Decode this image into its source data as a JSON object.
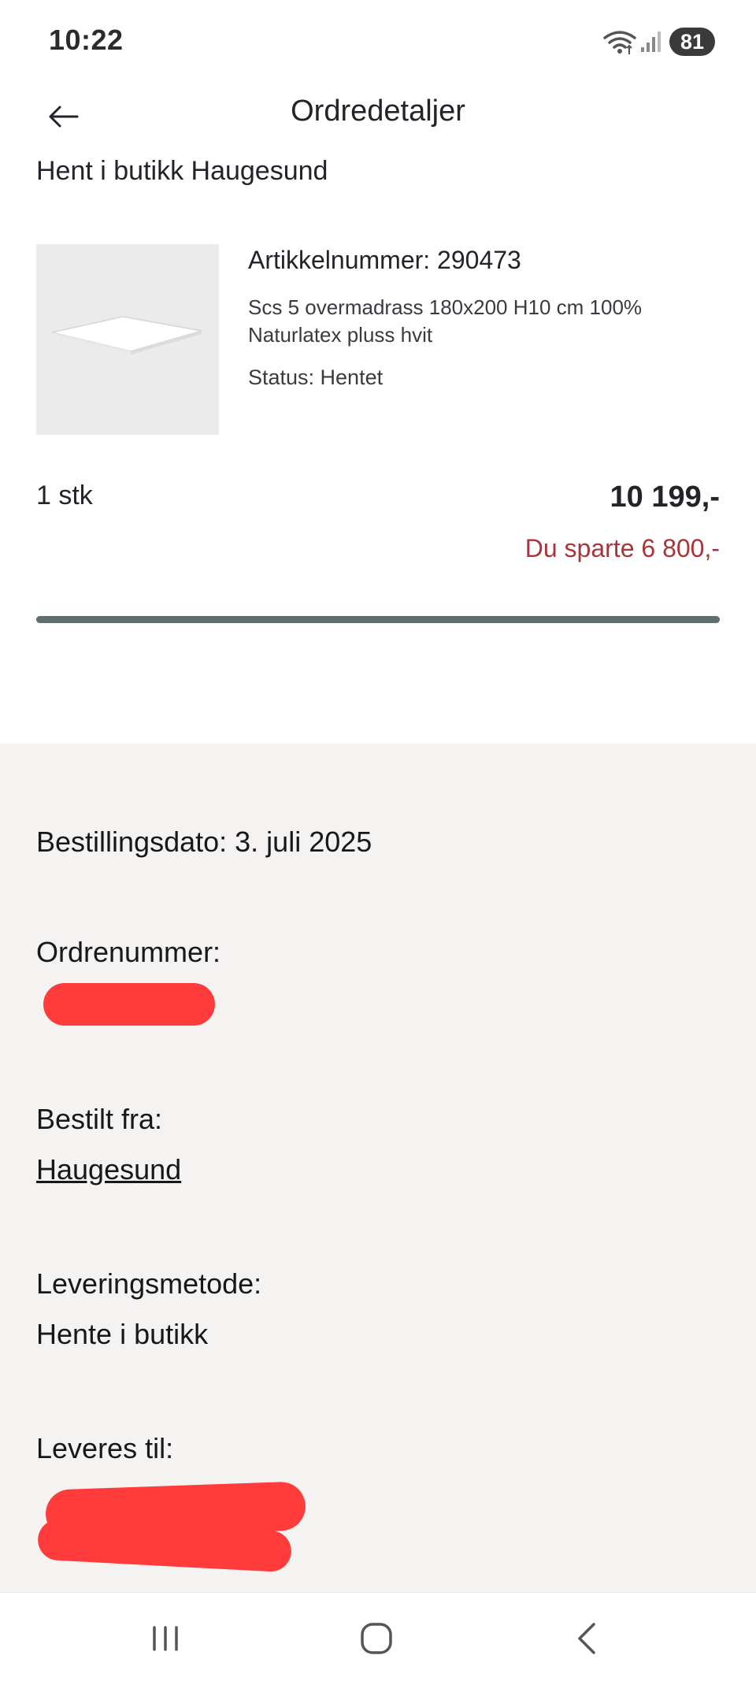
{
  "status_bar": {
    "time": "10:22",
    "battery": "81"
  },
  "header": {
    "title": "Ordredetaljer"
  },
  "pickup": {
    "heading": "Hent i butikk Haugesund"
  },
  "product": {
    "article_number": "Artikkelnummer: 290473",
    "description": "Scs 5 overmadrass 180x200 H10 cm 100% Naturlatex pluss hvit",
    "status": "Status: Hentet",
    "quantity": "1 stk",
    "price": "10 199,-",
    "saved": "Du sparte 6 800,-",
    "progress_fraction": 1.0
  },
  "order": {
    "date_label": "Bestillingsdato:",
    "date_value": "3. juli 2025",
    "number_label": "Ordrenummer:",
    "ordered_from_label": "Bestilt fra:",
    "ordered_from_value": "Haugesund",
    "delivery_method_label": "Leveringsmetode:",
    "delivery_method_value": "Hente i butikk",
    "delivered_to_label": "Leveres til:"
  },
  "colors": {
    "accent_red": "#a8353a",
    "progress": "#5f6d6c",
    "info_bg": "#f4f3f2"
  }
}
